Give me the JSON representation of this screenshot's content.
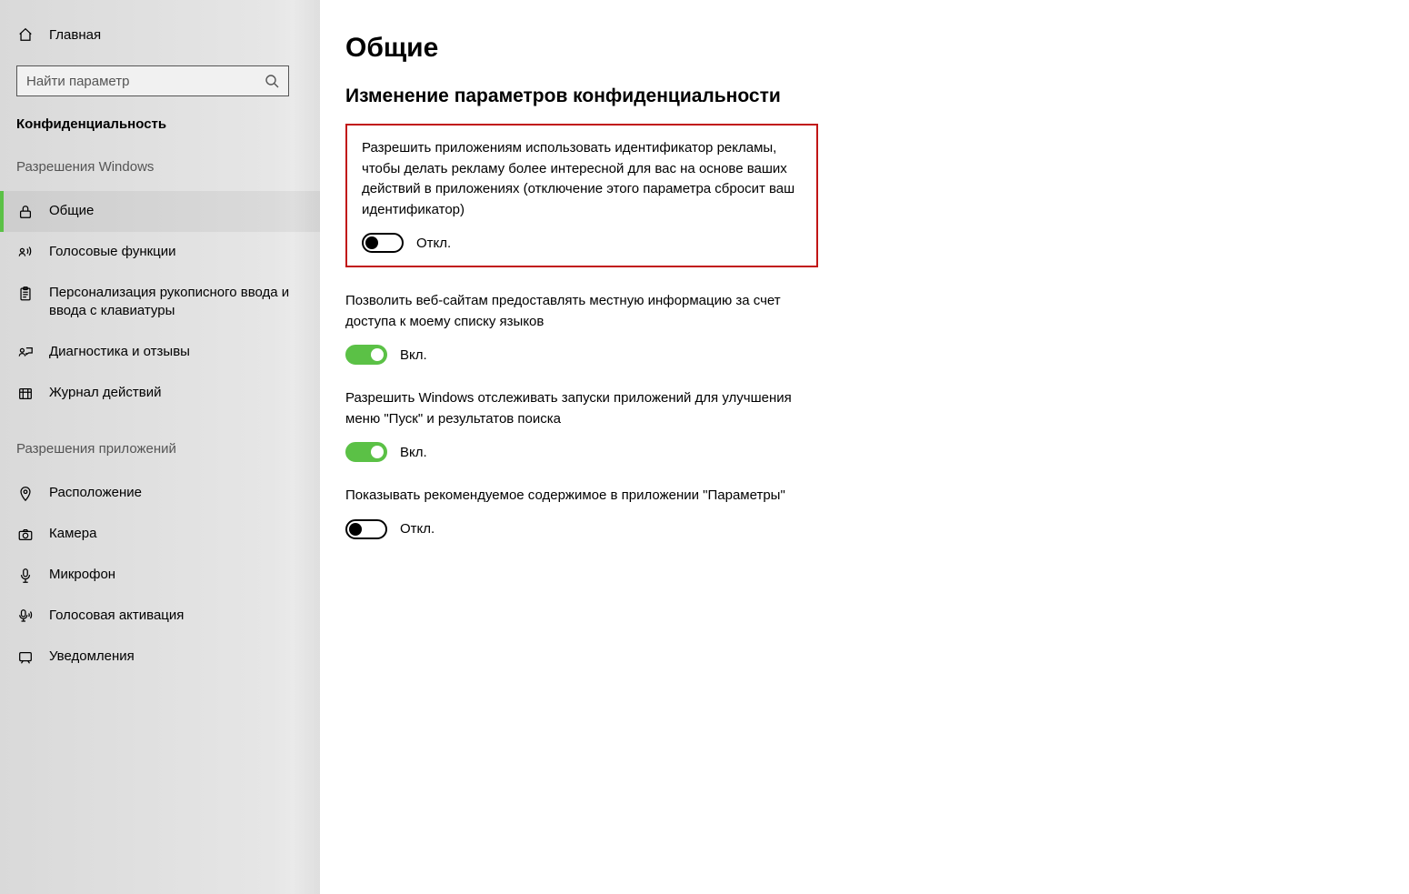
{
  "sidebar": {
    "home_label": "Главная",
    "search_placeholder": "Найти параметр",
    "section_header": "Конфиденциальность",
    "group1_title": "Разрешения Windows",
    "group1_items": [
      {
        "label": "Общие"
      },
      {
        "label": "Голосовые функции"
      },
      {
        "label": "Персонализация рукописного ввода и ввода с клавиатуры"
      },
      {
        "label": "Диагностика и отзывы"
      },
      {
        "label": "Журнал действий"
      }
    ],
    "group2_title": "Разрешения приложений",
    "group2_items": [
      {
        "label": "Расположение"
      },
      {
        "label": "Камера"
      },
      {
        "label": "Микрофон"
      },
      {
        "label": "Голосовая активация"
      },
      {
        "label": "Уведомления"
      }
    ]
  },
  "main": {
    "page_title": "Общие",
    "subheading": "Изменение параметров конфиденциальности",
    "settings": [
      {
        "desc": "Разрешить приложениям использовать идентификатор рекламы, чтобы делать рекламу более интересной для вас на основе ваших действий в приложениях (отключение этого параметра сбросит ваш идентификатор)",
        "state_label": "Откл.",
        "on": false,
        "highlight": true
      },
      {
        "desc": "Позволить веб-сайтам предоставлять местную информацию за счет доступа к моему списку языков",
        "state_label": "Вкл.",
        "on": true,
        "highlight": false
      },
      {
        "desc": "Разрешить Windows отслеживать запуски приложений для улучшения меню \"Пуск\" и результатов поиска",
        "state_label": "Вкл.",
        "on": true,
        "highlight": false
      },
      {
        "desc": "Показывать рекомендуемое содержимое в приложении \"Параметры\"",
        "state_label": "Откл.",
        "on": false,
        "highlight": false
      }
    ]
  }
}
